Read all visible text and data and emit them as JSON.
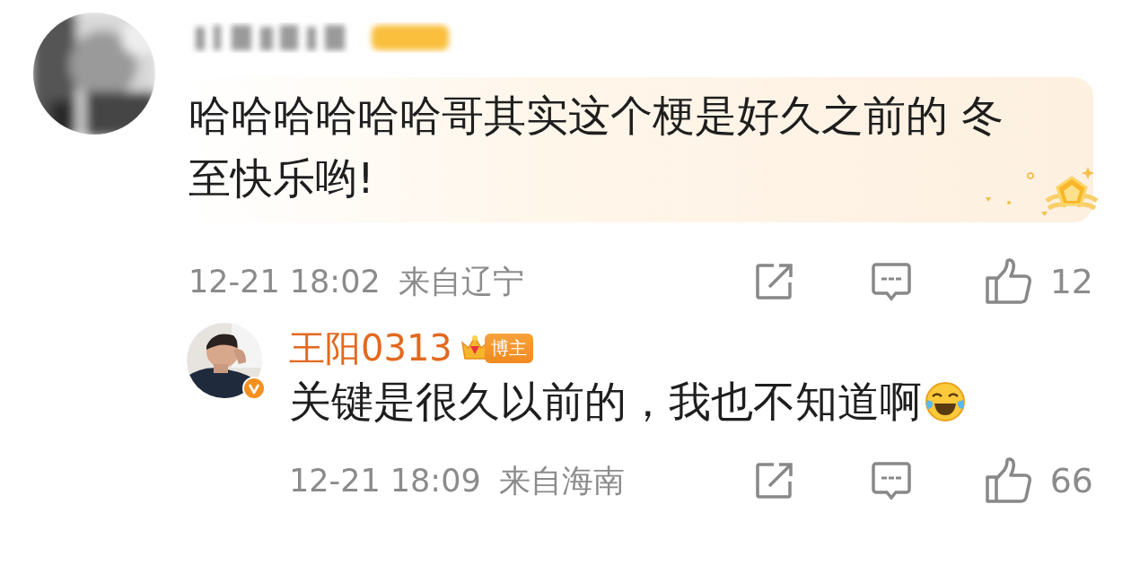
{
  "comments": [
    {
      "author": {
        "kind": "blurred"
      },
      "highlighted": true,
      "text": "哈哈哈哈哈哈哥其实这个梗是好久之前的 冬至快乐哟!",
      "time": "12-21 18:02",
      "location": "来自辽宁",
      "likes": "12",
      "replies": [
        {
          "author": {
            "kind": "named",
            "name": "王阳0313",
            "badge": "博主",
            "verified": true
          },
          "text": "关键是很久以前的，我也不知道啊",
          "emoji": true,
          "time": "12-21 18:09",
          "location": "来自海南",
          "likes": "66"
        }
      ]
    }
  ]
}
